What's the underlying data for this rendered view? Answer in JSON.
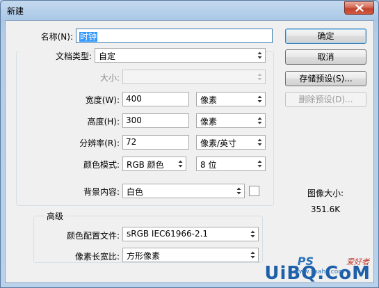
{
  "window": {
    "title": "新建"
  },
  "form": {
    "name_label": "名称(N):",
    "name_value": "时钟",
    "preset_label": "文档类型:",
    "preset_value": "自定",
    "size_label": "大小:",
    "size_value": "",
    "width_label": "宽度(W):",
    "width_value": "400",
    "width_unit": "像素",
    "height_label": "高度(H):",
    "height_value": "300",
    "height_unit": "像素",
    "resolution_label": "分辨率(R):",
    "resolution_value": "72",
    "resolution_unit": "像素/英寸",
    "color_mode_label": "颜色模式:",
    "color_mode_value": "RGB 颜色",
    "bit_depth_value": "8 位",
    "background_label": "背景内容:",
    "background_value": "白色"
  },
  "advanced": {
    "title": "高级",
    "color_profile_label": "颜色配置文件:",
    "color_profile_value": "sRGB IEC61966-2.1",
    "pixel_aspect_label": "像素长宽比:",
    "pixel_aspect_value": "方形像素"
  },
  "buttons": {
    "ok": "确定",
    "cancel": "取消",
    "save_preset": "存储预设(S)...",
    "delete_preset": "删除预设(D)..."
  },
  "image_size": {
    "label": "图像大小:",
    "value": "351.6K"
  },
  "watermark": {
    "brand": "UiBQ.CoM",
    "ps": "PS",
    "cn": "爱好者",
    "url": "www.psahz.com"
  },
  "colors": {
    "accent": "#3399ff",
    "title_bar": "#b9d1ea",
    "close": "#c0432d"
  }
}
